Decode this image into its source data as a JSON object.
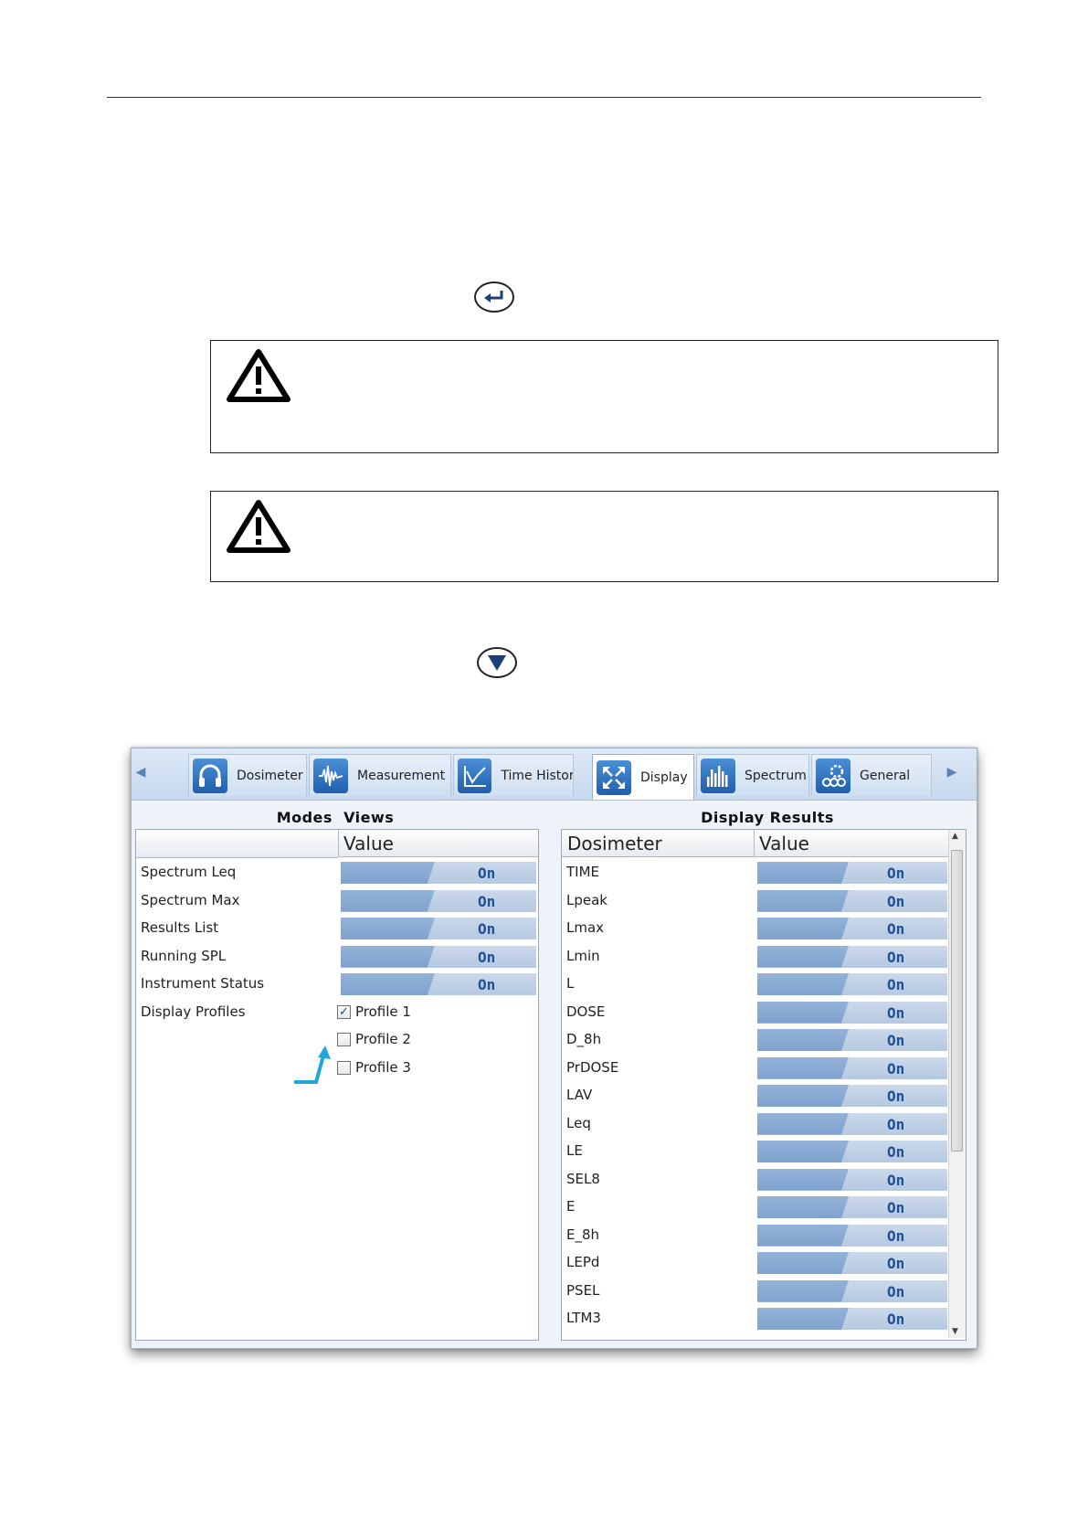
{
  "window": {
    "tabs": [
      {
        "label": "Dosimeter",
        "icon": "headphones-icon"
      },
      {
        "label": "Measurement",
        "icon": "waveform-icon"
      },
      {
        "label": "Time Histor",
        "icon": "line-chart-icon"
      },
      {
        "label": "Display",
        "icon": "expand-arrows-icon"
      },
      {
        "label": "Spectrum",
        "icon": "bar-spectrum-icon"
      },
      {
        "label": "General",
        "icon": "gears-icon"
      }
    ],
    "active_tab": "Display",
    "left_panel": {
      "title": "Modes  Views",
      "value_header": "Value",
      "rows": [
        {
          "label": "Spectrum Leq",
          "value": "On"
        },
        {
          "label": "Spectrum Max",
          "value": "On"
        },
        {
          "label": "Results List",
          "value": "On"
        },
        {
          "label": "Running SPL",
          "value": "On"
        },
        {
          "label": "Instrument Status",
          "value": "On"
        }
      ],
      "profiles_label": "Display Profiles",
      "profiles": [
        {
          "label": "Profile 1",
          "checked": true
        },
        {
          "label": "Profile 2",
          "checked": false
        },
        {
          "label": "Profile 3",
          "checked": false
        }
      ]
    },
    "right_panel": {
      "title": "Display Results",
      "name_header": "Dosimeter",
      "value_header": "Value",
      "rows": [
        {
          "label": "TIME",
          "value": "On"
        },
        {
          "label": "Lpeak",
          "value": "On"
        },
        {
          "label": "Lmax",
          "value": "On"
        },
        {
          "label": "Lmin",
          "value": "On"
        },
        {
          "label": "L",
          "value": "On"
        },
        {
          "label": "DOSE",
          "value": "On"
        },
        {
          "label": "D_8h",
          "value": "On"
        },
        {
          "label": "PrDOSE",
          "value": "On"
        },
        {
          "label": "LAV",
          "value": "On"
        },
        {
          "label": "Leq",
          "value": "On"
        },
        {
          "label": "LE",
          "value": "On"
        },
        {
          "label": "SEL8",
          "value": "On"
        },
        {
          "label": "E",
          "value": "On"
        },
        {
          "label": "E_8h",
          "value": "On"
        },
        {
          "label": "LEPd",
          "value": "On"
        },
        {
          "label": "PSEL",
          "value": "On"
        },
        {
          "label": "LTM3",
          "value": "On"
        }
      ]
    }
  },
  "colors": {
    "accent_arrow": "#1fa7dd",
    "value_text": "#1f4f96",
    "value_fill": "#8fb0d6"
  }
}
